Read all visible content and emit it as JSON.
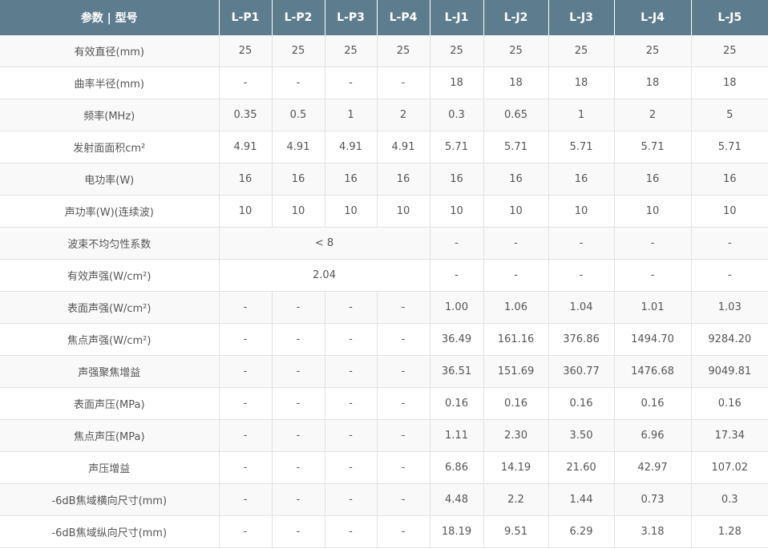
{
  "table": {
    "header": [
      "参数 | 型号",
      "L-P1",
      "L-P2",
      "L-P3",
      "L-P4",
      "L-J1",
      "L-J2",
      "L-J3",
      "L-J4",
      "L-J5"
    ],
    "rows": [
      {
        "label": "有效直径(mm)",
        "cells": [
          "25",
          "25",
          "25",
          "25",
          "25",
          "25",
          "25",
          "25",
          "25"
        ]
      },
      {
        "label": "曲率半径(mm)",
        "cells": [
          "-",
          "-",
          "-",
          "-",
          "18",
          "18",
          "18",
          "18",
          "18"
        ]
      },
      {
        "label": "频率(MHz)",
        "cells": [
          "0.35",
          "0.5",
          "1",
          "2",
          "0.3",
          "0.65",
          "1",
          "2",
          "5"
        ]
      },
      {
        "label": "发射面面积cm²",
        "cells": [
          "4.91",
          "4.91",
          "4.91",
          "4.91",
          "5.71",
          "5.71",
          "5.71",
          "5.71",
          "5.71"
        ]
      },
      {
        "label": "电功率(W)",
        "cells": [
          "16",
          "16",
          "16",
          "16",
          "16",
          "16",
          "16",
          "16",
          "16"
        ]
      },
      {
        "label": "声功率(W)(连续波)",
        "cells": [
          "10",
          "10",
          "10",
          "10",
          "10",
          "10",
          "10",
          "10",
          "10"
        ]
      },
      {
        "label": "波束不均匀性系数",
        "merged": "< 8",
        "cells": [
          "-",
          "-",
          "-",
          "-",
          "-"
        ]
      },
      {
        "label": "有效声强(W/cm²)",
        "merged": "2.04",
        "cells": [
          "-",
          "-",
          "-",
          "-",
          "-"
        ]
      },
      {
        "label": "表面声强(W/cm²)",
        "cells": [
          "-",
          "-",
          "-",
          "-",
          "1.00",
          "1.06",
          "1.04",
          "1.01",
          "1.03"
        ]
      },
      {
        "label": "焦点声强(W/cm²)",
        "cells": [
          "-",
          "-",
          "-",
          "-",
          "36.49",
          "161.16",
          "376.86",
          "1494.70",
          "9284.20"
        ]
      },
      {
        "label": "声强聚焦增益",
        "cells": [
          "-",
          "-",
          "-",
          "-",
          "36.51",
          "151.69",
          "360.77",
          "1476.68",
          "9049.81"
        ]
      },
      {
        "label": "表面声压(MPa)",
        "cells": [
          "-",
          "-",
          "-",
          "-",
          "0.16",
          "0.16",
          "0.16",
          "0.16",
          "0.16"
        ]
      },
      {
        "label": "焦点声压(MPa)",
        "cells": [
          "-",
          "-",
          "-",
          "-",
          "1.11",
          "2.30",
          "3.50",
          "6.96",
          "17.34"
        ]
      },
      {
        "label": "声压增益",
        "cells": [
          "-",
          "-",
          "-",
          "-",
          "6.86",
          "14.19",
          "21.60",
          "42.97",
          "107.02"
        ]
      },
      {
        "label": "-6dB焦域横向尺寸(mm)",
        "cells": [
          "-",
          "-",
          "-",
          "-",
          "4.48",
          "2.2",
          "1.44",
          "0.73",
          "0.3"
        ]
      },
      {
        "label": "-6dB焦域纵向尺寸(mm)",
        "cells": [
          "-",
          "-",
          "-",
          "-",
          "18.19",
          "9.51",
          "6.29",
          "3.18",
          "1.28"
        ]
      }
    ]
  }
}
